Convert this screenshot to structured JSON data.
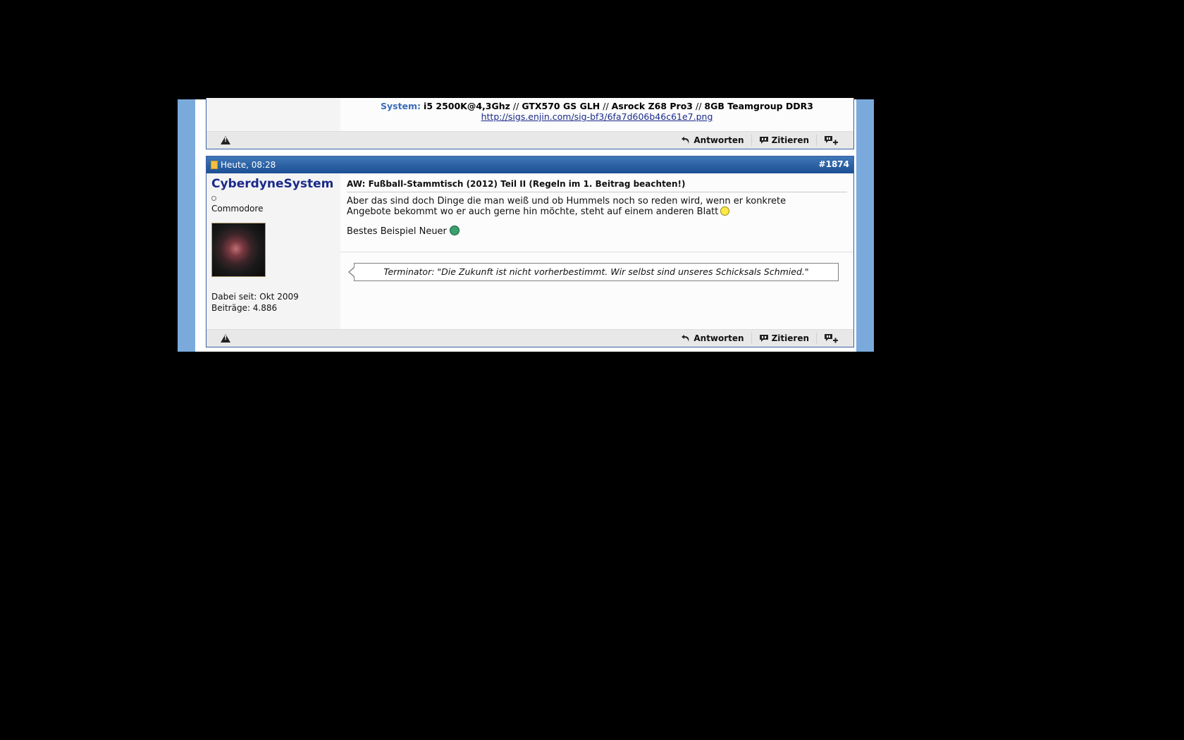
{
  "previous_post": {
    "signature": {
      "label": "System:",
      "cpu": "i5 2500K@4,3Ghz",
      "sep1": " // ",
      "gpu": "GTX570 GS GLH",
      "sep2": " // ",
      "board": "Asrock Z68 Pro3",
      "sep3": " // ",
      "ram": "8GB Teamgroup DDR3",
      "link": "http://sigs.enjin.com/sig-bf3/6fa7d606b46c61e7.png"
    },
    "footer": {
      "reply_label": "Antworten",
      "quote_label": "Zitieren"
    }
  },
  "post": {
    "date": "Heute, 08:28",
    "number": "#1874",
    "username": "CyberdyneSystem",
    "usertitle": "Commodore",
    "joined": "Dabei seit: Okt 2009",
    "posts": "Beiträge: 4.886",
    "title": "AW: Fußball-Stammtisch (2012) Teil II (Regeln im 1. Beitrag beachten!)",
    "text_p1": "Aber das sind doch Dinge die man weiß und ob Hummels noch so reden wird, wenn er konkrete Angebote bekommt wo er auch gerne hin möchte, steht auf einem anderen Blatt",
    "text_p2": "Bestes Beispiel Neuer",
    "signature": "Terminator: \"Die Zukunft ist nicht vorherbestimmt. Wir selbst sind unseres Schicksals Schmied.\"",
    "footer": {
      "reply_label": "Antworten",
      "quote_label": "Zitieren"
    }
  },
  "colors": {
    "header_blue": "#1c4f93",
    "side_blue": "#7aaadc",
    "username": "#1a2a8a"
  }
}
